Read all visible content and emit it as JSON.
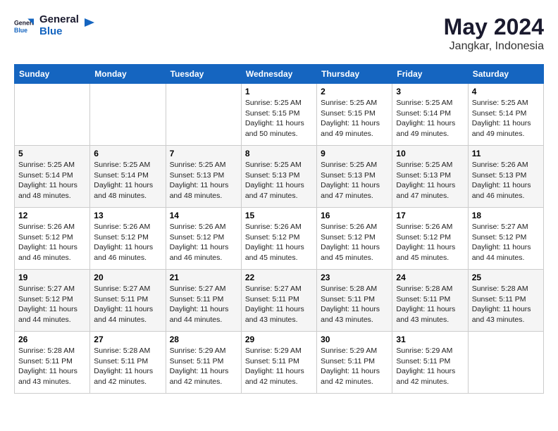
{
  "logo": {
    "line1": "General",
    "line2": "Blue"
  },
  "title": "May 2024",
  "subtitle": "Jangkar, Indonesia",
  "days_header": [
    "Sunday",
    "Monday",
    "Tuesday",
    "Wednesday",
    "Thursday",
    "Friday",
    "Saturday"
  ],
  "weeks": [
    [
      {
        "day": "",
        "info": ""
      },
      {
        "day": "",
        "info": ""
      },
      {
        "day": "",
        "info": ""
      },
      {
        "day": "1",
        "info": "Sunrise: 5:25 AM\nSunset: 5:15 PM\nDaylight: 11 hours\nand 50 minutes."
      },
      {
        "day": "2",
        "info": "Sunrise: 5:25 AM\nSunset: 5:15 PM\nDaylight: 11 hours\nand 49 minutes."
      },
      {
        "day": "3",
        "info": "Sunrise: 5:25 AM\nSunset: 5:14 PM\nDaylight: 11 hours\nand 49 minutes."
      },
      {
        "day": "4",
        "info": "Sunrise: 5:25 AM\nSunset: 5:14 PM\nDaylight: 11 hours\nand 49 minutes."
      }
    ],
    [
      {
        "day": "5",
        "info": "Sunrise: 5:25 AM\nSunset: 5:14 PM\nDaylight: 11 hours\nand 48 minutes."
      },
      {
        "day": "6",
        "info": "Sunrise: 5:25 AM\nSunset: 5:14 PM\nDaylight: 11 hours\nand 48 minutes."
      },
      {
        "day": "7",
        "info": "Sunrise: 5:25 AM\nSunset: 5:13 PM\nDaylight: 11 hours\nand 48 minutes."
      },
      {
        "day": "8",
        "info": "Sunrise: 5:25 AM\nSunset: 5:13 PM\nDaylight: 11 hours\nand 47 minutes."
      },
      {
        "day": "9",
        "info": "Sunrise: 5:25 AM\nSunset: 5:13 PM\nDaylight: 11 hours\nand 47 minutes."
      },
      {
        "day": "10",
        "info": "Sunrise: 5:25 AM\nSunset: 5:13 PM\nDaylight: 11 hours\nand 47 minutes."
      },
      {
        "day": "11",
        "info": "Sunrise: 5:26 AM\nSunset: 5:13 PM\nDaylight: 11 hours\nand 46 minutes."
      }
    ],
    [
      {
        "day": "12",
        "info": "Sunrise: 5:26 AM\nSunset: 5:12 PM\nDaylight: 11 hours\nand 46 minutes."
      },
      {
        "day": "13",
        "info": "Sunrise: 5:26 AM\nSunset: 5:12 PM\nDaylight: 11 hours\nand 46 minutes."
      },
      {
        "day": "14",
        "info": "Sunrise: 5:26 AM\nSunset: 5:12 PM\nDaylight: 11 hours\nand 46 minutes."
      },
      {
        "day": "15",
        "info": "Sunrise: 5:26 AM\nSunset: 5:12 PM\nDaylight: 11 hours\nand 45 minutes."
      },
      {
        "day": "16",
        "info": "Sunrise: 5:26 AM\nSunset: 5:12 PM\nDaylight: 11 hours\nand 45 minutes."
      },
      {
        "day": "17",
        "info": "Sunrise: 5:26 AM\nSunset: 5:12 PM\nDaylight: 11 hours\nand 45 minutes."
      },
      {
        "day": "18",
        "info": "Sunrise: 5:27 AM\nSunset: 5:12 PM\nDaylight: 11 hours\nand 44 minutes."
      }
    ],
    [
      {
        "day": "19",
        "info": "Sunrise: 5:27 AM\nSunset: 5:12 PM\nDaylight: 11 hours\nand 44 minutes."
      },
      {
        "day": "20",
        "info": "Sunrise: 5:27 AM\nSunset: 5:11 PM\nDaylight: 11 hours\nand 44 minutes."
      },
      {
        "day": "21",
        "info": "Sunrise: 5:27 AM\nSunset: 5:11 PM\nDaylight: 11 hours\nand 44 minutes."
      },
      {
        "day": "22",
        "info": "Sunrise: 5:27 AM\nSunset: 5:11 PM\nDaylight: 11 hours\nand 43 minutes."
      },
      {
        "day": "23",
        "info": "Sunrise: 5:28 AM\nSunset: 5:11 PM\nDaylight: 11 hours\nand 43 minutes."
      },
      {
        "day": "24",
        "info": "Sunrise: 5:28 AM\nSunset: 5:11 PM\nDaylight: 11 hours\nand 43 minutes."
      },
      {
        "day": "25",
        "info": "Sunrise: 5:28 AM\nSunset: 5:11 PM\nDaylight: 11 hours\nand 43 minutes."
      }
    ],
    [
      {
        "day": "26",
        "info": "Sunrise: 5:28 AM\nSunset: 5:11 PM\nDaylight: 11 hours\nand 43 minutes."
      },
      {
        "day": "27",
        "info": "Sunrise: 5:28 AM\nSunset: 5:11 PM\nDaylight: 11 hours\nand 42 minutes."
      },
      {
        "day": "28",
        "info": "Sunrise: 5:29 AM\nSunset: 5:11 PM\nDaylight: 11 hours\nand 42 minutes."
      },
      {
        "day": "29",
        "info": "Sunrise: 5:29 AM\nSunset: 5:11 PM\nDaylight: 11 hours\nand 42 minutes."
      },
      {
        "day": "30",
        "info": "Sunrise: 5:29 AM\nSunset: 5:11 PM\nDaylight: 11 hours\nand 42 minutes."
      },
      {
        "day": "31",
        "info": "Sunrise: 5:29 AM\nSunset: 5:11 PM\nDaylight: 11 hours\nand 42 minutes."
      },
      {
        "day": "",
        "info": ""
      }
    ]
  ]
}
